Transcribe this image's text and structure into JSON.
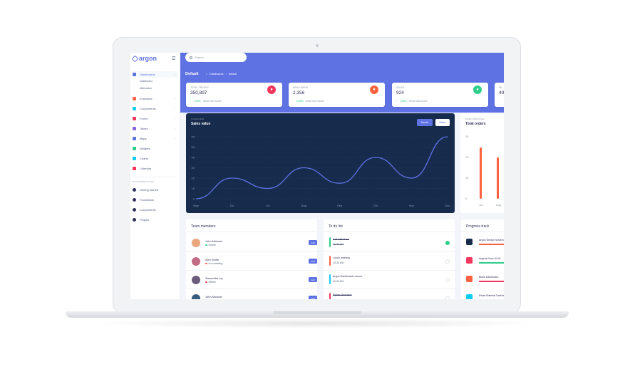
{
  "app": {
    "logo": "argon"
  },
  "sidebar": {
    "items": [
      {
        "label": "Dashboards",
        "color": "#5e72e4",
        "active": true
      },
      {
        "label": "Examples",
        "color": "#fb6340"
      },
      {
        "label": "Components",
        "color": "#11cdef"
      },
      {
        "label": "Forms",
        "color": "#f5365c"
      },
      {
        "label": "Tables",
        "color": "#8965e0"
      },
      {
        "label": "Maps",
        "color": "#5e72e4"
      },
      {
        "label": "Widgets",
        "color": "#2dce89"
      },
      {
        "label": "Charts",
        "color": "#11cdef"
      },
      {
        "label": "Calendar",
        "color": "#f5365c"
      }
    ],
    "sub_items": [
      "Dashboard",
      "Alternative"
    ],
    "doc_title": "DOCUMENTATION",
    "doc_items": [
      {
        "label": "Getting started",
        "color": "#32325d"
      },
      {
        "label": "Foundation",
        "color": "#32325d"
      },
      {
        "label": "Components",
        "color": "#32325d"
      },
      {
        "label": "Plugins",
        "color": "#32325d"
      }
    ]
  },
  "header": {
    "search_placeholder": "Search",
    "title": "Default",
    "breadcrumb": [
      "Dashboards",
      "Default"
    ]
  },
  "stats": [
    {
      "label": "TOTAL TRAFFIC",
      "value": "350,897",
      "change": "3.48%",
      "since": "Since last month",
      "color": "#f5365c"
    },
    {
      "label": "NEW USERS",
      "value": "2,356",
      "change": "3.48%",
      "since": "Since last month",
      "color": "#fb6340"
    },
    {
      "label": "SALES",
      "value": "924",
      "change": "3.48%",
      "since": "Since last month",
      "color": "#2dce89"
    },
    {
      "label": "PE",
      "value": "49",
      "color": "#5e72e4"
    }
  ],
  "chart_data": [
    {
      "type": "line",
      "overline": "OVERVIEW",
      "title": "Sales value",
      "x": [
        "May",
        "Jun",
        "Jul",
        "Aug",
        "Sep",
        "Oct",
        "Nov",
        "Dec"
      ],
      "series": [
        {
          "values": [
            0,
            20,
            10,
            30,
            15,
            40,
            20,
            60
          ]
        }
      ],
      "yticks": [
        0,
        10,
        20,
        30,
        40,
        50,
        60
      ],
      "ylim": [
        0,
        60
      ],
      "grid": true,
      "buttons": [
        "Month",
        "Week"
      ]
    },
    {
      "type": "bar",
      "overline": "PERFORMANCE",
      "title": "Total orders",
      "x": [
        "Jul",
        "Aug"
      ],
      "series": [
        {
          "values": [
            25,
            20
          ]
        }
      ],
      "yticks": [
        0,
        10,
        20,
        30
      ],
      "ylim": [
        0,
        30
      ]
    }
  ],
  "team": {
    "title": "Team members",
    "members": [
      {
        "name": "John Michael",
        "status": "Online",
        "dot": "#2dce89",
        "avatar": "#e8a87c"
      },
      {
        "name": "Alex Smith",
        "status": "In a meeting",
        "dot": "#fb6340",
        "avatar": "#c06c84"
      },
      {
        "name": "Samantha Ivy",
        "status": "Offline",
        "dot": "#f5365c",
        "avatar": "#6c5b7b"
      },
      {
        "name": "John Michael",
        "status": "",
        "dot": "#2dce89",
        "avatar": "#355c7d"
      }
    ],
    "add_label": "Add"
  },
  "todo": {
    "title": "To do list",
    "items": [
      {
        "title": "Call with Dave",
        "time": "10:30 AM",
        "color": "#2dce89",
        "done": true
      },
      {
        "title": "Lunch meeting",
        "time": "10:30 AM",
        "color": "#fb6340",
        "done": false
      },
      {
        "title": "Argon Dashboard Launch",
        "time": "10:30 AM",
        "color": "#11cdef",
        "done": false
      },
      {
        "title": "Winter Hackaton",
        "time": "",
        "color": "#f5365c",
        "done": true
      }
    ]
  },
  "progress": {
    "title": "Progress track",
    "items": [
      {
        "title": "Argon Design System",
        "color": "#172b4d",
        "pct": 60,
        "bar": "#fb6340"
      },
      {
        "title": "Angular Now UI Kit",
        "color": "#f5365c",
        "pct": 100,
        "bar": "#2dce89"
      },
      {
        "title": "Black Dashboard",
        "color": "#fb6340",
        "pct": 72,
        "bar": "#f5365c"
      },
      {
        "title": "React Material Dashboard",
        "color": "#11cdef",
        "pct": 90,
        "bar": "#11cdef"
      }
    ]
  }
}
